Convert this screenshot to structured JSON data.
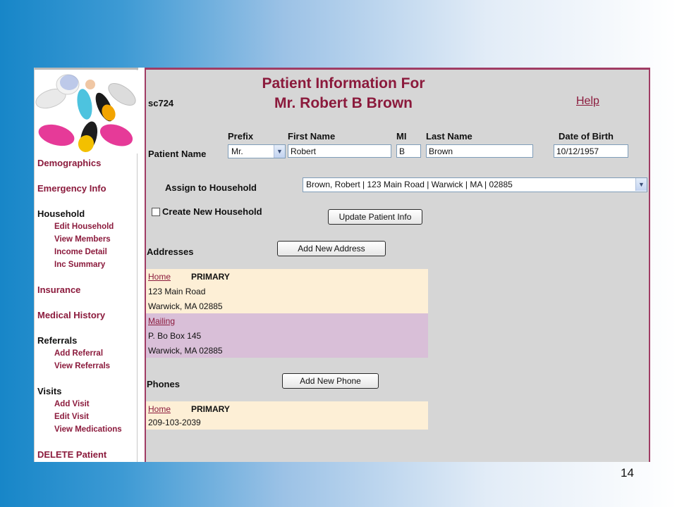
{
  "sidebar": {
    "logo": "pill-collage",
    "items": {
      "demographics": "Demographics",
      "emergency": "Emergency Info",
      "household": "Household",
      "edit_household": "Edit Household",
      "view_members": "View Members",
      "income_detail": "Income Detail",
      "inc_summary": "Inc Summary",
      "insurance": "Insurance",
      "medical_history": "Medical History",
      "referrals": "Referrals",
      "add_referral": "Add Referral",
      "view_referrals": "View Referrals",
      "visits": "Visits",
      "add_visit": "Add Visit",
      "edit_visit": "Edit Visit",
      "view_medications": "View Medications",
      "delete_patient": "DELETE Patient"
    }
  },
  "header": {
    "code": "sc724",
    "title_line1": "Patient Information For",
    "title_line2": "Mr. Robert B Brown",
    "help": "Help"
  },
  "patient_name": {
    "label": "Patient Name",
    "prefix_label": "Prefix",
    "prefix_value": "Mr.",
    "first_label": "First Name",
    "first_value": "Robert",
    "mi_label": "MI",
    "mi_value": "B",
    "last_label": "Last Name",
    "last_value": "Brown",
    "dob_label": "Date of Birth",
    "dob_value": "10/12/1957"
  },
  "household": {
    "label": "Assign to Household",
    "value": "Brown, Robert | 123 Main Road | Warwick | MA | 02885",
    "create_label": "Create New Household"
  },
  "buttons": {
    "update": "Update Patient Info",
    "add_address": "Add New Address",
    "add_phone": "Add New Phone"
  },
  "addresses": {
    "label": "Addresses",
    "list": [
      {
        "type": "Home",
        "flag": "PRIMARY",
        "line1": "123 Main Road",
        "line2": "Warwick, MA 02885",
        "color": "#fdefd6"
      },
      {
        "type": "Mailing",
        "flag": "",
        "line1": "P. Bo Box 145",
        "line2": "Warwick, MA 02885",
        "color": "#d9bfd8"
      }
    ]
  },
  "phones": {
    "label": "Phones",
    "list": [
      {
        "type": "Home",
        "flag": "PRIMARY",
        "number": "209-103-2039",
        "color": "#fdefd6"
      }
    ]
  },
  "page_number": "14",
  "colors": {
    "accent": "#8b1a3c",
    "panel": "#d6d6d6",
    "frame": "#a03c64"
  }
}
